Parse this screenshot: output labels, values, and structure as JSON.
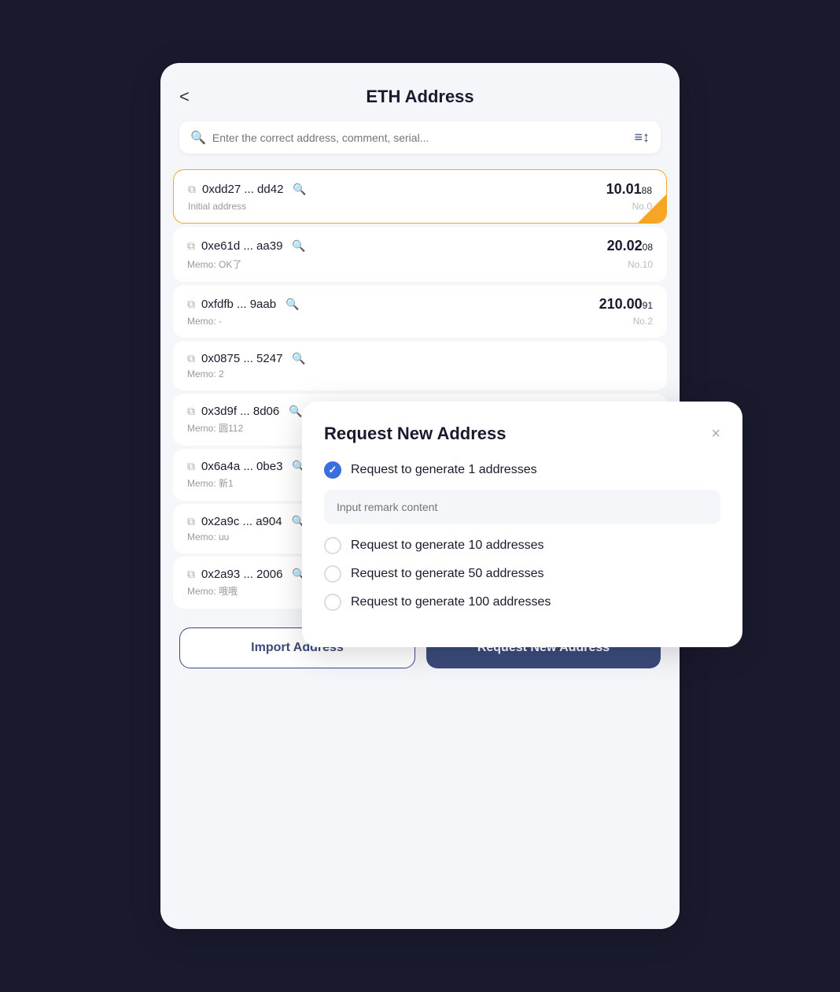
{
  "header": {
    "title": "ETH Address",
    "back_label": "<"
  },
  "search": {
    "placeholder": "Enter the correct address, comment, serial..."
  },
  "addresses": [
    {
      "address": "0xdd27 ... dd42",
      "memo": "Initial address",
      "amount_main": "10.01",
      "amount_small": "88",
      "no": "No.0",
      "active": true
    },
    {
      "address": "0xe61d ... aa39",
      "memo": "Memo: OK了",
      "amount_main": "20.02",
      "amount_small": "08",
      "no": "No.10",
      "active": false
    },
    {
      "address": "0xfdfb ... 9aab",
      "memo": "Memo: -",
      "amount_main": "210.00",
      "amount_small": "91",
      "no": "No.2",
      "active": false
    },
    {
      "address": "0x0875 ... 5247",
      "memo": "Memo: 2",
      "amount_main": "",
      "amount_small": "",
      "no": "",
      "active": false
    },
    {
      "address": "0x3d9f ... 8d06",
      "memo": "Memo: 圆112",
      "amount_main": "",
      "amount_small": "",
      "no": "",
      "active": false
    },
    {
      "address": "0x6a4a ... 0be3",
      "memo": "Memo: 新1",
      "amount_main": "",
      "amount_small": "",
      "no": "",
      "active": false
    },
    {
      "address": "0x2a9c ... a904",
      "memo": "Memo: uu",
      "amount_main": "",
      "amount_small": "",
      "no": "",
      "active": false
    },
    {
      "address": "0x2a93 ... 2006",
      "memo": "Memo: 哦哦",
      "amount_main": "",
      "amount_small": "",
      "no": "",
      "active": false
    }
  ],
  "footer": {
    "import_label": "Import Address",
    "request_label": "Request New Address"
  },
  "modal": {
    "title": "Request New Address",
    "close_label": "×",
    "remark_placeholder": "Input remark content",
    "options": [
      {
        "label": "Request to generate 1 addresses",
        "checked": true
      },
      {
        "label": "Request to generate 10 addresses",
        "checked": false
      },
      {
        "label": "Request to generate 50 addresses",
        "checked": false
      },
      {
        "label": "Request to generate 100 addresses",
        "checked": false
      }
    ]
  }
}
